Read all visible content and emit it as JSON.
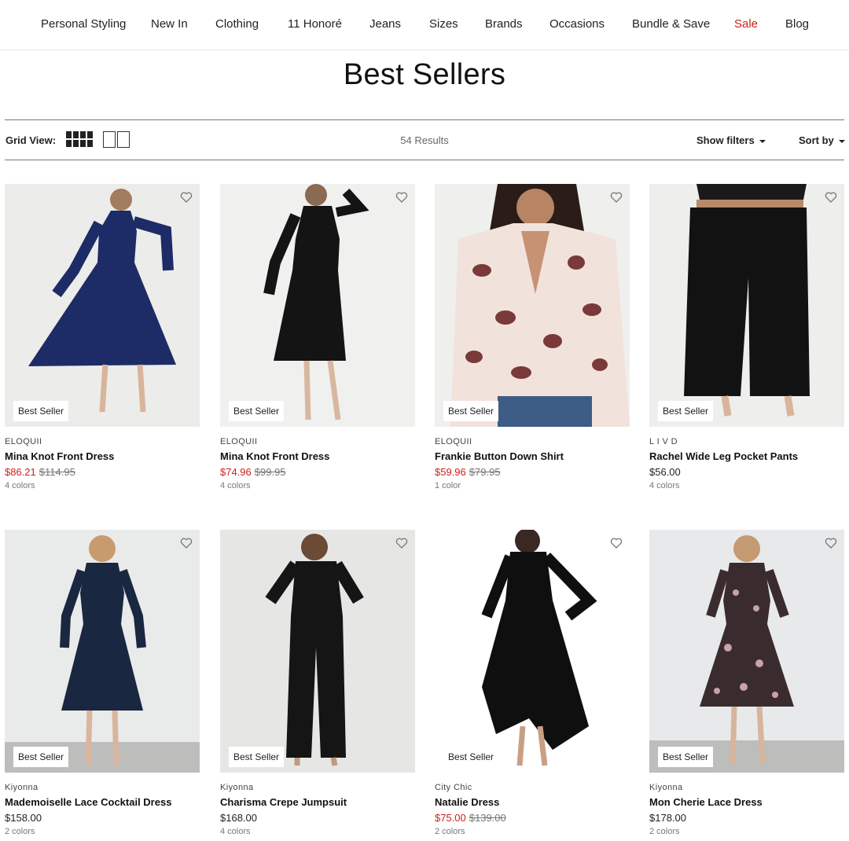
{
  "nav": {
    "items": [
      "Personal Styling",
      "New In",
      "Clothing",
      "11 Honoré",
      "Jeans",
      "Sizes",
      "Brands",
      "Occasions",
      "Bundle & Save",
      "Sale",
      "Blog"
    ],
    "sale_color": "#d0201a"
  },
  "page": {
    "title": "Best Sellers"
  },
  "toolbar": {
    "grid_view_label": "Grid View:",
    "results": "54 Results",
    "show_filters": "Show filters",
    "sort_by": "Sort by"
  },
  "icons": {
    "grid_4": "grid-4-icon",
    "grid_2": "grid-2-icon",
    "wishlist": "heart-icon",
    "dropdown": "caret-down-icon"
  },
  "products": [
    {
      "badge": "Best Seller",
      "brand": "ELOQUII",
      "name": "Mina Knot Front Dress",
      "price": "$86.21",
      "original_price": "$114.95",
      "colors": "4 colors"
    },
    {
      "badge": "Best Seller",
      "brand": "ELOQUII",
      "name": "Mina Knot Front Dress",
      "price": "$74.96",
      "original_price": "$99.95",
      "colors": "4 colors"
    },
    {
      "badge": "Best Seller",
      "brand": "ELOQUII",
      "name": "Frankie Button Down Shirt",
      "price": "$59.96",
      "original_price": "$79.95",
      "colors": "1 color"
    },
    {
      "badge": "Best Seller",
      "brand": "L I V D",
      "name": "Rachel Wide Leg Pocket Pants",
      "price": "$56.00",
      "original_price": "",
      "colors": "4 colors"
    },
    {
      "badge": "Best Seller",
      "brand": "Kiyonna",
      "name": "Mademoiselle Lace Cocktail Dress",
      "price": "$158.00",
      "original_price": "",
      "colors": "2 colors"
    },
    {
      "badge": "Best Seller",
      "brand": "Kiyonna",
      "name": "Charisma Crepe Jumpsuit",
      "price": "$168.00",
      "original_price": "",
      "colors": "4 colors"
    },
    {
      "badge": "Best Seller",
      "brand": "City Chic",
      "name": "Natalie Dress",
      "price": "$75.00",
      "original_price": "$139.00",
      "colors": "2 colors"
    },
    {
      "badge": "Best Seller",
      "brand": "Kiyonna",
      "name": "Mon Cherie Lace Dress",
      "price": "$178.00",
      "original_price": "",
      "colors": "2 colors"
    }
  ]
}
